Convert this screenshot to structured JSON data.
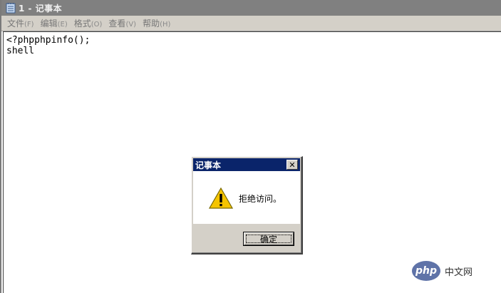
{
  "window": {
    "title": "1 - 记事本"
  },
  "menu": [
    {
      "label": "文件",
      "hotkey": "(F)"
    },
    {
      "label": "编辑",
      "hotkey": "(E)"
    },
    {
      "label": "格式",
      "hotkey": "(O)"
    },
    {
      "label": "查看",
      "hotkey": "(V)"
    },
    {
      "label": "帮助",
      "hotkey": "(H)"
    }
  ],
  "editor": {
    "lines": [
      "<?phpphpinfo();",
      "shell"
    ]
  },
  "dialog": {
    "title": "记事本",
    "message": "拒绝访问。",
    "ok_label": "确定",
    "icon": "warning-icon",
    "close_icon": "close-icon"
  },
  "watermark": {
    "logo_text": "php",
    "text": "中文网"
  },
  "colors": {
    "titlebar_inactive": "#808080",
    "dialog_titlebar": "#0a246a",
    "chrome": "#d4d0c8",
    "warning_yellow": "#f5c400",
    "watermark_blue": "#5f73a8"
  }
}
